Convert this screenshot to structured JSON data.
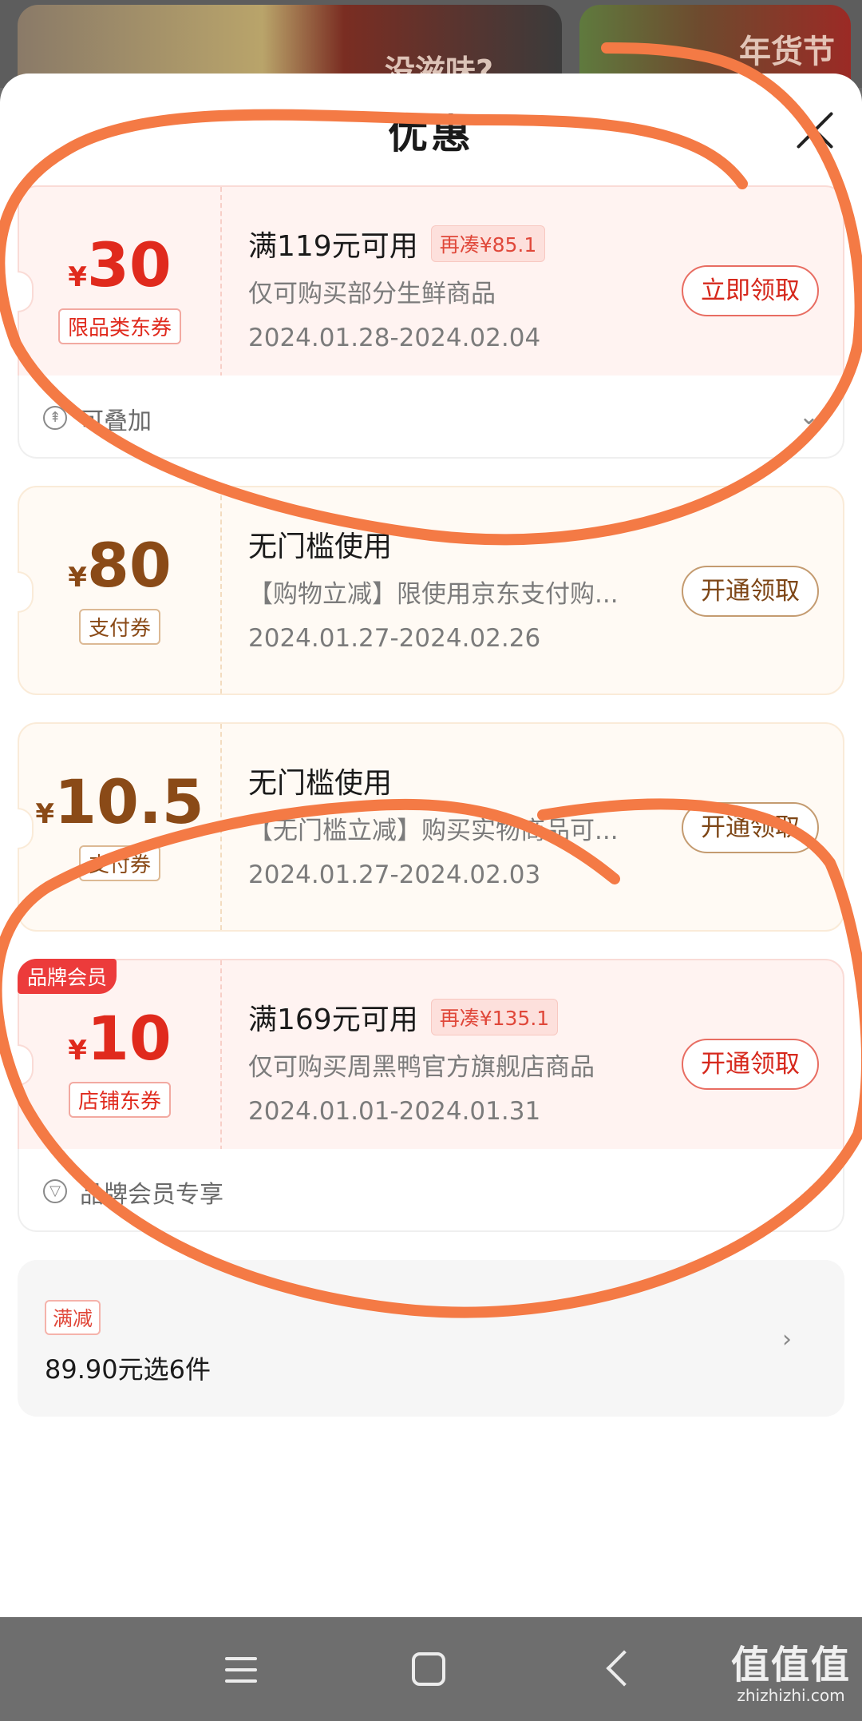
{
  "background": {
    "card1_text": "没滋味?",
    "card2_text": "年货节"
  },
  "sheet": {
    "title": "优惠",
    "close_icon": "close-icon"
  },
  "coupons": [
    {
      "currency": "¥",
      "amount": "30",
      "type": "限品类东券",
      "condition": "满119元可用",
      "extra": "再凑¥85.1",
      "description": "仅可购买部分生鲜商品",
      "date_range": "2024.01.28-2024.02.04",
      "button": "立即领取",
      "footer": "可叠加",
      "footer_icon": "stack-icon",
      "theme": "red"
    },
    {
      "currency": "¥",
      "amount": "80",
      "type": "支付券",
      "condition": "无门槛使用",
      "description": "【购物立减】限使用京东支付购...",
      "date_range": "2024.01.27-2024.02.26",
      "button": "开通领取",
      "theme": "tan"
    },
    {
      "currency": "¥",
      "amount": "10.5",
      "type": "支付券",
      "condition": "无门槛使用",
      "description": "【无门槛立减】购买实物商品可...",
      "date_range": "2024.01.27-2024.02.03",
      "button": "开通领取",
      "theme": "tan"
    },
    {
      "badge": "品牌会员",
      "currency": "¥",
      "amount": "10",
      "type": "店铺东券",
      "condition": "满169元可用",
      "extra": "再凑¥135.1",
      "description": "仅可购买周黑鸭官方旗舰店商品",
      "date_range": "2024.01.01-2024.01.31",
      "button": "开通领取",
      "footer": "品牌会员专享",
      "footer_icon": "member-icon",
      "theme": "red"
    }
  ],
  "promo": {
    "tag": "满减",
    "text": "89.90元选6件"
  },
  "navbar": {
    "watermark_big": "值值值",
    "watermark_small": "zhizhizhi.com"
  },
  "colors": {
    "accent_red": "#e02a1d",
    "accent_brown": "#8a4a17",
    "scribble": "#f47a45"
  }
}
